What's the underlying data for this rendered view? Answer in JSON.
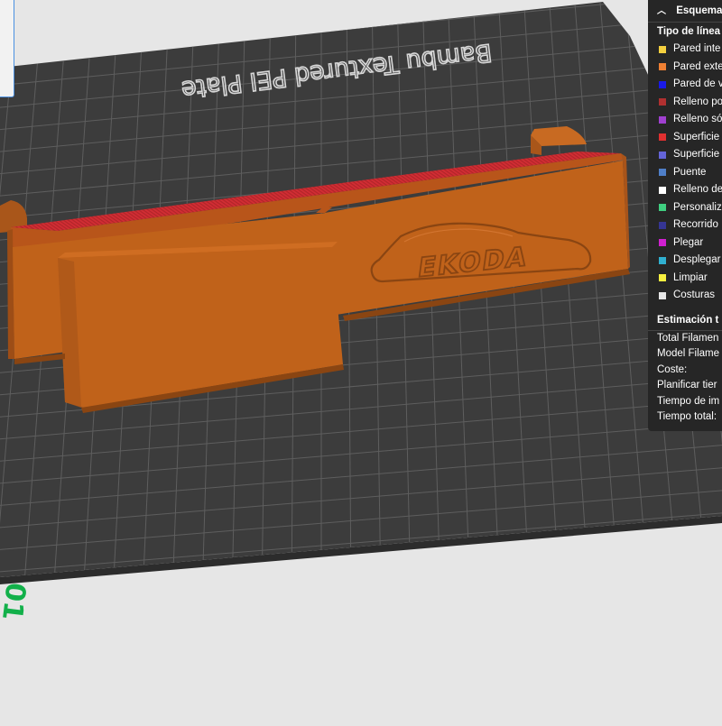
{
  "plate": {
    "label": "Bambu Textured PEI Plate",
    "plate_number": "01",
    "colors": {
      "plate": "#3c3c3c",
      "grid": "#5e5e5e",
      "number": "#12b04a",
      "background": "#e6e6e6"
    }
  },
  "model": {
    "logo_text": "EKODA",
    "colors": {
      "body": "#c0621a",
      "top_surface": "#d22d34"
    }
  },
  "legend": {
    "header": "Esquema",
    "line_type_title": "Tipo de línea",
    "items": [
      {
        "label": "Pared inte",
        "color": "#f4d03f"
      },
      {
        "label": "Pared exte",
        "color": "#ef8033"
      },
      {
        "label": "Pared de v",
        "color": "#1a1ae8"
      },
      {
        "label": "Relleno po",
        "color": "#b03030"
      },
      {
        "label": "Relleno só",
        "color": "#a040d0"
      },
      {
        "label": "Superficie",
        "color": "#e03030"
      },
      {
        "label": "Superficie",
        "color": "#6464d8"
      },
      {
        "label": "Puente",
        "color": "#4f7fc8"
      },
      {
        "label": "Relleno de",
        "color": "#ffffff"
      },
      {
        "label": "Personaliz",
        "color": "#3fcf80"
      },
      {
        "label": "Recorrido",
        "color": "#353594"
      },
      {
        "label": "Plegar",
        "color": "#d020d0"
      },
      {
        "label": "Desplegar",
        "color": "#30b0d0"
      },
      {
        "label": "Limpiar",
        "color": "#f8f040"
      },
      {
        "label": "Costuras",
        "color": "#e6e6e6"
      }
    ],
    "estimation_title": "Estimación t",
    "estimation_rows": [
      "Total Filamen",
      "Model Filame",
      "Coste:",
      "Planificar tier",
      "Tiempo de im",
      "Tiempo total:"
    ]
  }
}
